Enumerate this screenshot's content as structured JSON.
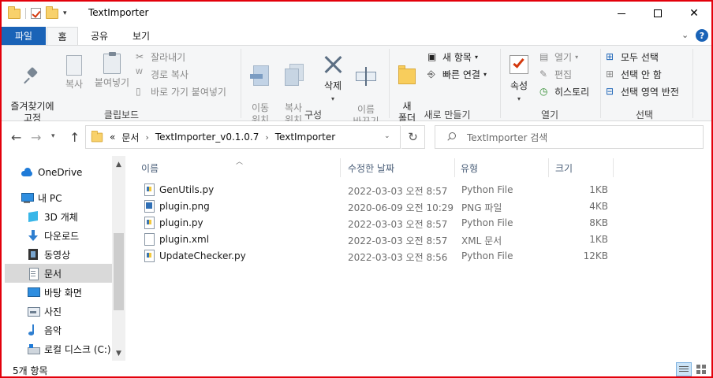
{
  "window": {
    "title": "TextImporter"
  },
  "tabs": [
    {
      "label": "파일"
    },
    {
      "label": "홈"
    },
    {
      "label": "공유"
    },
    {
      "label": "보기"
    }
  ],
  "ribbon": {
    "clipboard": {
      "pin_label": "즐겨찾기에\n고정",
      "copy_label": "복사",
      "paste_label": "붙여넣기",
      "cut_label": "잘라내기",
      "copy_path_label": "경로 복사",
      "paste_shortcut_label": "바로 가기 붙여넣기",
      "group_label": "클립보드"
    },
    "organize": {
      "move_label": "이동\n위치",
      "copy_to_label": "복사\n위치",
      "delete_label": "삭제",
      "rename_label": "이름\n바꾸기",
      "group_label": "구성"
    },
    "new": {
      "new_folder_label": "새\n폴더",
      "new_item_label": "새 항목",
      "easy_access_label": "빠른 연결",
      "group_label": "새로 만들기"
    },
    "open": {
      "properties_label": "속성",
      "open_label": "열기",
      "edit_label": "편집",
      "history_label": "히스토리",
      "group_label": "열기"
    },
    "select": {
      "select_all_label": "모두 선택",
      "select_none_label": "선택 안 함",
      "invert_label": "선택 영역 반전",
      "group_label": "선택"
    }
  },
  "address": {
    "overflow": "«",
    "crumbs": [
      "문서",
      "TextImporter_v0.1.0.7",
      "TextImporter"
    ]
  },
  "search": {
    "placeholder": "TextImporter 검색"
  },
  "nav_pane": {
    "items": [
      {
        "label": "OneDrive",
        "icon": "onedrive-icon"
      },
      {
        "label": "내 PC",
        "icon": "pc-icon"
      },
      {
        "label": "3D 개체",
        "icon": "3d-objects-icon"
      },
      {
        "label": "다운로드",
        "icon": "downloads-icon"
      },
      {
        "label": "동영상",
        "icon": "videos-icon"
      },
      {
        "label": "문서",
        "icon": "documents-icon",
        "selected": true
      },
      {
        "label": "바탕 화면",
        "icon": "desktop-icon"
      },
      {
        "label": "사진",
        "icon": "pictures-icon"
      },
      {
        "label": "음악",
        "icon": "music-icon"
      },
      {
        "label": "로컬 디스크 (C:)",
        "icon": "disk-icon"
      }
    ]
  },
  "columns": {
    "name": "이름",
    "date": "수정한 날짜",
    "type": "유형",
    "size": "크기"
  },
  "files": [
    {
      "name": "GenUtils.py",
      "date": "2022-03-03 오전 8:57",
      "type": "Python File",
      "size": "1KB",
      "icon": "python-file-icon"
    },
    {
      "name": "plugin.png",
      "date": "2020-06-09 오전 10:29",
      "type": "PNG 파일",
      "size": "4KB",
      "icon": "png-file-icon"
    },
    {
      "name": "plugin.py",
      "date": "2022-03-03 오전 8:57",
      "type": "Python File",
      "size": "8KB",
      "icon": "python-file-icon"
    },
    {
      "name": "plugin.xml",
      "date": "2022-03-03 오전 8:57",
      "type": "XML 문서",
      "size": "1KB",
      "icon": "xml-file-icon"
    },
    {
      "name": "UpdateChecker.py",
      "date": "2022-03-03 오전 8:56",
      "type": "Python File",
      "size": "12KB",
      "icon": "python-file-icon"
    }
  ],
  "status": {
    "count": "5개 항목"
  },
  "colors": {
    "accent": "#1a63b7",
    "selected": "#d9d9d9",
    "frame": "#e3000b"
  }
}
